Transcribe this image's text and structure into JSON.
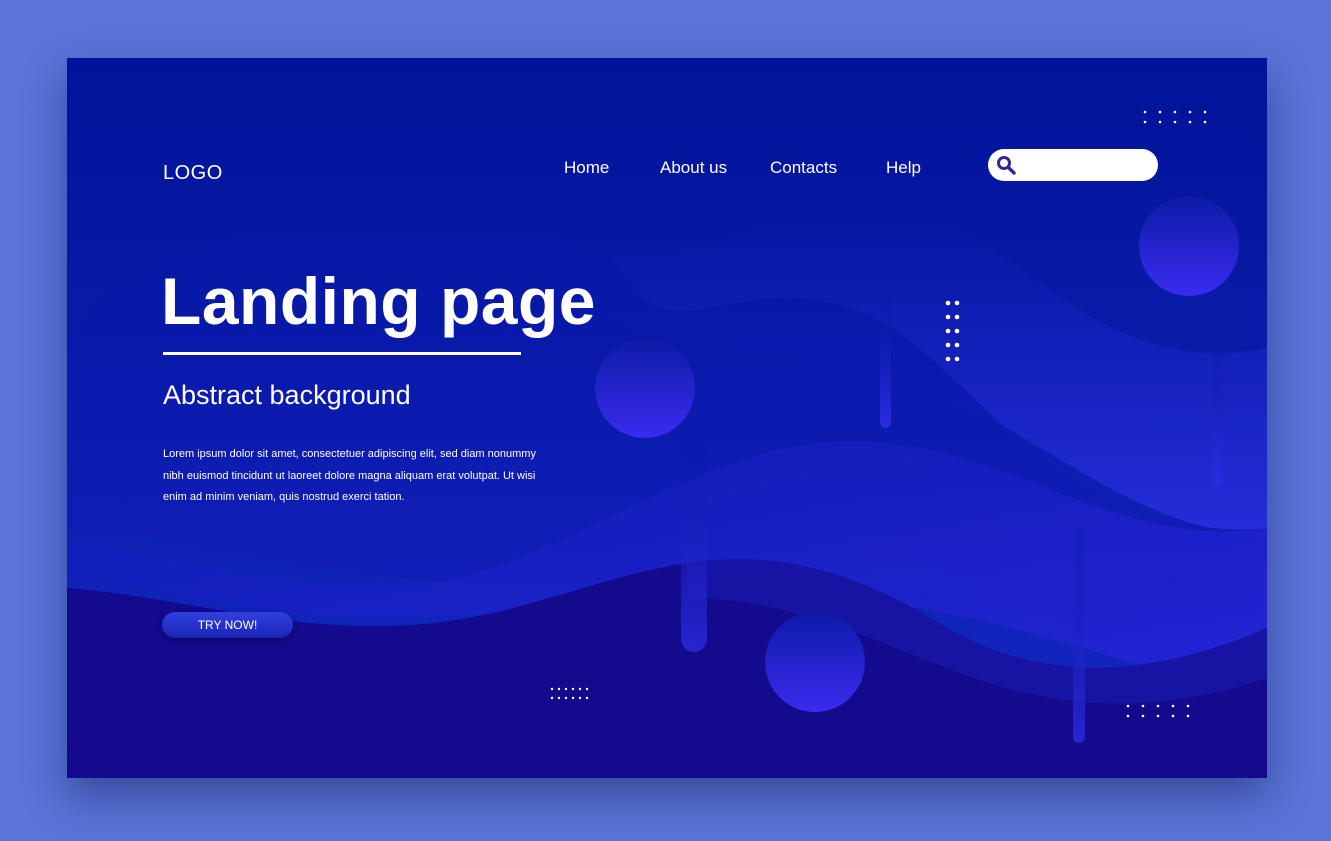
{
  "header": {
    "logo": "LOGO",
    "nav": [
      {
        "label": "Home"
      },
      {
        "label": "About us"
      },
      {
        "label": "Contacts"
      },
      {
        "label": "Help"
      }
    ],
    "search": {
      "placeholder": "",
      "value": "",
      "icon": "search-icon"
    }
  },
  "hero": {
    "title": "Landing page",
    "subtitle": "Abstract background",
    "body": "Lorem ipsum dolor sit amet, consectetuer adipiscing elit, sed diam nonummy nibh euismod tincidunt ut laoreet dolore magna aliquam erat volutpat. Ut wisi enim ad minim veniam, quis nostrud exerci tation.",
    "cta_label": "TRY NOW!"
  },
  "colors": {
    "page_bg": "#5a74d8",
    "frame_top": "#01139a",
    "frame_bottom": "#1428c4",
    "accent": "#3a2cf0",
    "search_icon": "#3b2490",
    "text": "#ffffff"
  }
}
